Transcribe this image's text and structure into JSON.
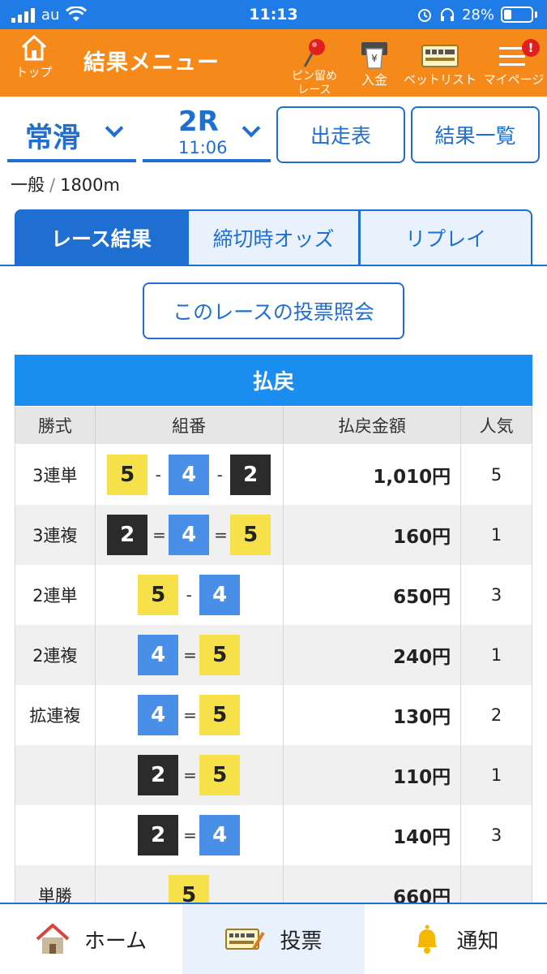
{
  "status_bar": {
    "carrier": "au",
    "time": "11:13",
    "battery": "28%"
  },
  "header": {
    "top_label": "トップ",
    "title": "結果メニュー",
    "pin_label_1": "ピン留め",
    "pin_label_2": "レース",
    "deposit_label": "入金",
    "betlist_label": "ベットリスト",
    "mypage_label": "マイページ",
    "mypage_badge": "!"
  },
  "race_selector": {
    "venue": "常滑",
    "race": "2R",
    "race_time": "11:06",
    "entries_button": "出走表",
    "results_list_button": "結果一覧"
  },
  "race_meta": {
    "grade": "一般",
    "separator": "/",
    "distance": "1800m"
  },
  "tabs": [
    {
      "label": "レース結果",
      "active": true
    },
    {
      "label": "締切時オッズ",
      "active": false
    },
    {
      "label": "リプレイ",
      "active": false
    }
  ],
  "vote_inquiry_button": "このレースの投票照会",
  "payout": {
    "section_title": "払戻",
    "headers": [
      "勝式",
      "組番",
      "払戻金額",
      "人気"
    ],
    "rows": [
      {
        "kind": "3連単",
        "boats": [
          "5",
          "4",
          "2"
        ],
        "seps": [
          "-",
          "-"
        ],
        "amount": "1,010円",
        "popularity": "5"
      },
      {
        "kind": "3連複",
        "boats": [
          "2",
          "4",
          "5"
        ],
        "seps": [
          "=",
          "="
        ],
        "amount": "160円",
        "popularity": "1"
      },
      {
        "kind": "2連単",
        "boats": [
          "5",
          "4"
        ],
        "seps": [
          "-"
        ],
        "amount": "650円",
        "popularity": "3"
      },
      {
        "kind": "2連複",
        "boats": [
          "4",
          "5"
        ],
        "seps": [
          "="
        ],
        "amount": "240円",
        "popularity": "1"
      },
      {
        "kind": "拡連複",
        "boats": [
          "4",
          "5"
        ],
        "seps": [
          "="
        ],
        "amount": "130円",
        "popularity": "2"
      },
      {
        "kind": "",
        "boats": [
          "2",
          "5"
        ],
        "seps": [
          "="
        ],
        "amount": "110円",
        "popularity": "1"
      },
      {
        "kind": "",
        "boats": [
          "2",
          "4"
        ],
        "seps": [
          "="
        ],
        "amount": "140円",
        "popularity": "3"
      },
      {
        "kind": "単勝",
        "boats": [
          "5"
        ],
        "seps": [],
        "amount": "660円",
        "popularity": ""
      }
    ]
  },
  "boat_colors": {
    "2": {
      "bg": "#2b2b2b",
      "fg": "#ffffff"
    },
    "4": {
      "bg": "#4a8fe7",
      "fg": "#ffffff"
    },
    "5": {
      "bg": "#f7e14a",
      "fg": "#222222"
    }
  },
  "bottom_nav": {
    "home": "ホーム",
    "vote": "投票",
    "notify": "通知"
  },
  "colors": {
    "header_orange": "#f58a1a",
    "primary_blue": "#1f6fd2",
    "table_header_blue": "#1a8ef0"
  }
}
